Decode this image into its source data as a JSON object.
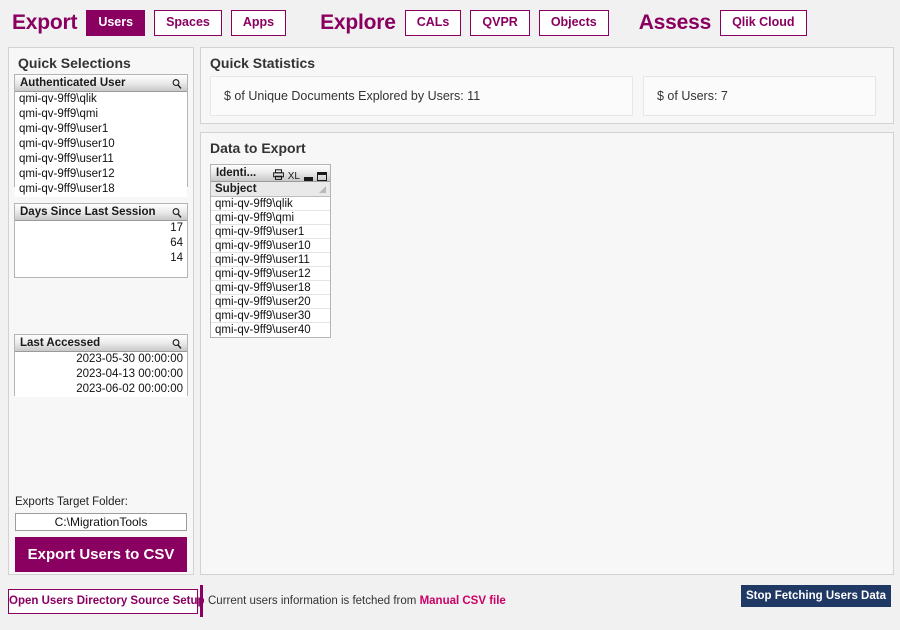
{
  "topnav": {
    "groups": [
      {
        "title": "Export",
        "buttons": [
          {
            "label": "Users",
            "active": true
          },
          {
            "label": "Spaces",
            "active": false
          },
          {
            "label": "Apps",
            "active": false
          }
        ]
      },
      {
        "title": "Explore",
        "buttons": [
          {
            "label": "CALs",
            "active": false
          },
          {
            "label": "QVPR",
            "active": false
          },
          {
            "label": "Objects",
            "active": false
          }
        ]
      },
      {
        "title": "Assess",
        "buttons": [
          {
            "label": "Qlik Cloud",
            "active": false
          }
        ]
      }
    ]
  },
  "left_panel": {
    "title": "Quick Selections",
    "listboxes": [
      {
        "header": "Authenticated User",
        "search_icon": "magnifier-icon",
        "align": "left",
        "rows": [
          "qmi-qv-9ff9\\qlik",
          "qmi-qv-9ff9\\qmi",
          "qmi-qv-9ff9\\user1",
          "qmi-qv-9ff9\\user10",
          "qmi-qv-9ff9\\user11",
          "qmi-qv-9ff9\\user12",
          "qmi-qv-9ff9\\user18"
        ]
      },
      {
        "header": "Days Since Last Session",
        "search_icon": "magnifier-icon",
        "align": "right",
        "rows": [
          "17",
          "64",
          "14"
        ]
      },
      {
        "header": "Last Accessed",
        "search_icon": "magnifier-icon",
        "align": "right",
        "rows": [
          "2023-05-30 00:00:00",
          "2023-04-13 00:00:00",
          "2023-06-02 00:00:00"
        ]
      }
    ],
    "folder_label": "Exports Target Folder:",
    "folder_value": "C:\\MigrationTools",
    "folder_placeholder": "C:\\MigrationTools",
    "export_button": "Export Users to CSV"
  },
  "open_dir_button": "Open Users Directory Source Setup",
  "stats_panel": {
    "title": "Quick Statistics",
    "boxes": [
      "$ of Unique Documents Explored by Users: 11",
      "$ of Users: 7"
    ]
  },
  "data_panel": {
    "title": "Data to Export",
    "table": {
      "caption": "Identi...",
      "icons": [
        "print-icon",
        "excel-export-icon",
        "minimize-icon",
        "maximize-icon"
      ],
      "excel_label": "XL",
      "column_header": "Subject",
      "sort_icon": "sort-ascending-icon",
      "rows": [
        "qmi-qv-9ff9\\qlik",
        "qmi-qv-9ff9\\qmi",
        "qmi-qv-9ff9\\user1",
        "qmi-qv-9ff9\\user10",
        "qmi-qv-9ff9\\user11",
        "qmi-qv-9ff9\\user12",
        "qmi-qv-9ff9\\user18",
        "qmi-qv-9ff9\\user20",
        "qmi-qv-9ff9\\user30",
        "qmi-qv-9ff9\\user40"
      ]
    }
  },
  "footer": {
    "text_prefix": "Current users information is fetched from ",
    "link": "Manual CSV file",
    "stop_button": "Stop Fetching Users Data"
  },
  "colors": {
    "brand_purple": "#8a0060",
    "link_pink": "#cc0066",
    "navy": "#1f3864",
    "page_bg": "#f1f1f1",
    "panel_bg": "#f7f7f7"
  }
}
